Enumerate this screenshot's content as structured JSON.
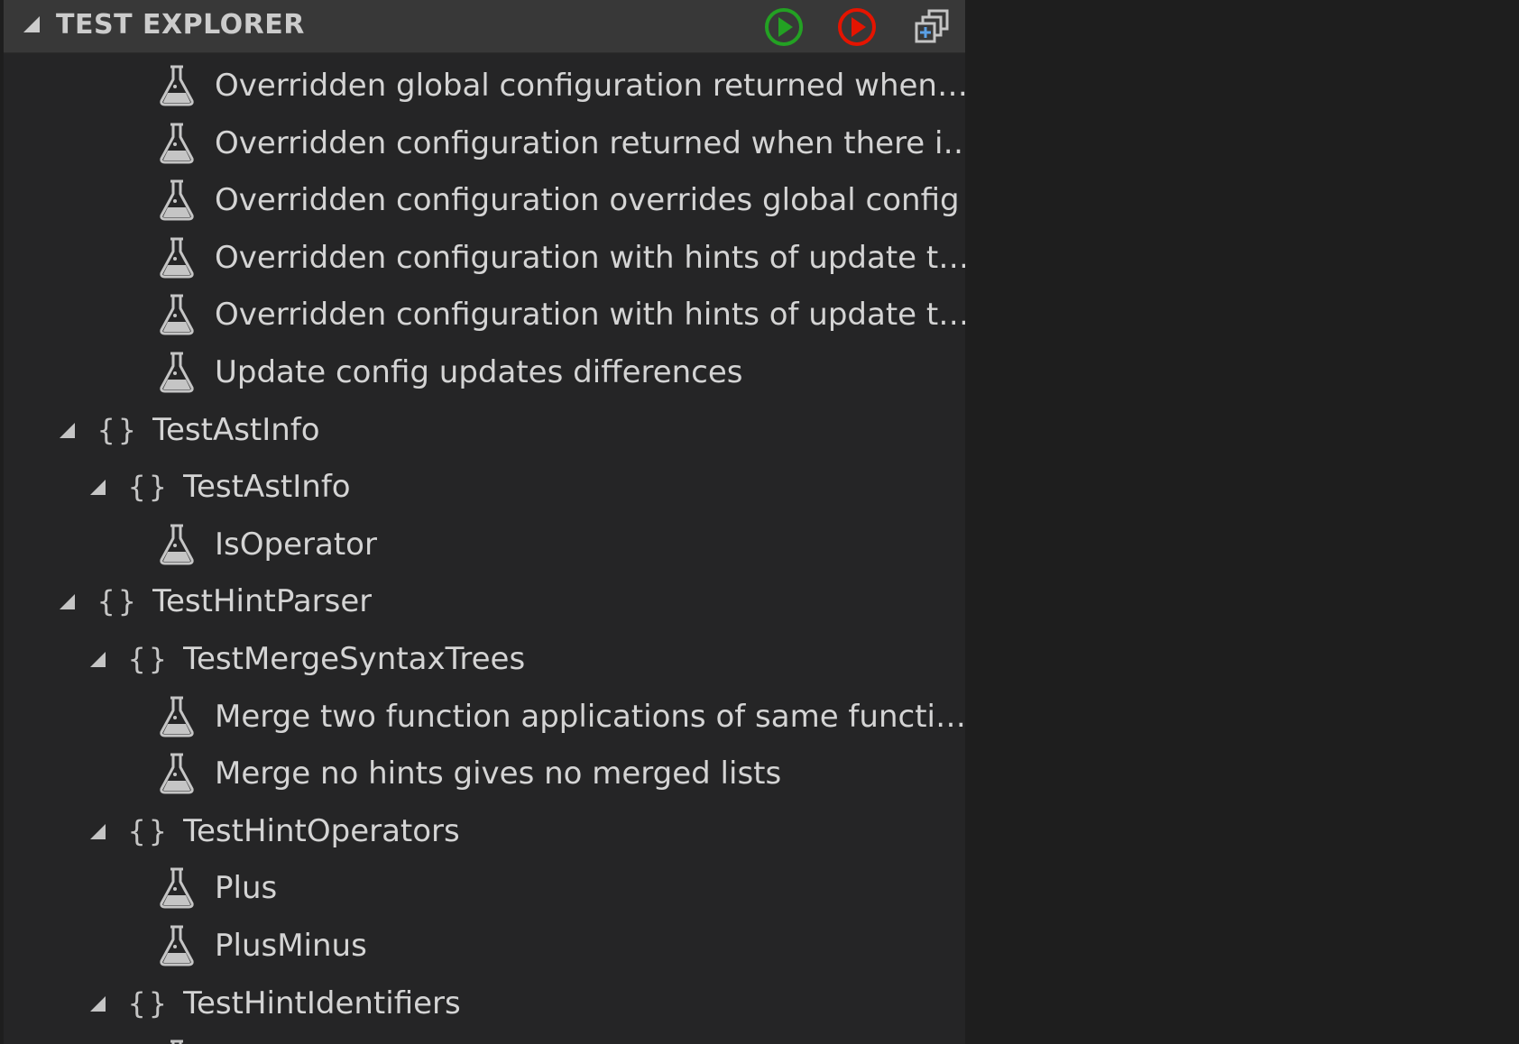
{
  "header": {
    "title": "TEST EXPLORER",
    "run_all_icon": "play-circle-icon",
    "run_all_color": "#23a123",
    "debug_all_icon": "debug-circle-icon",
    "debug_all_color": "#e51400",
    "collapse_all_icon": "collapse-all-icon"
  },
  "tree": [
    {
      "kind": "test",
      "depth": 3,
      "label": "Overridden global configuration returned when…"
    },
    {
      "kind": "test",
      "depth": 3,
      "label": "Overridden configuration returned when there i…"
    },
    {
      "kind": "test",
      "depth": 3,
      "label": "Overridden configuration overrides global config"
    },
    {
      "kind": "test",
      "depth": 3,
      "label": "Overridden configuration with hints of update t…"
    },
    {
      "kind": "test",
      "depth": 3,
      "label": "Overridden configuration with hints of update t…"
    },
    {
      "kind": "test",
      "depth": 3,
      "label": "Update config updates differences"
    },
    {
      "kind": "namespace",
      "depth": 1,
      "label": "TestAstInfo",
      "expanded": true
    },
    {
      "kind": "namespace",
      "depth": 2,
      "label": "TestAstInfo",
      "expanded": true
    },
    {
      "kind": "test",
      "depth": 3,
      "label": "IsOperator"
    },
    {
      "kind": "namespace",
      "depth": 1,
      "label": "TestHintParser",
      "expanded": true
    },
    {
      "kind": "namespace",
      "depth": 2,
      "label": "TestMergeSyntaxTrees",
      "expanded": true
    },
    {
      "kind": "test",
      "depth": 3,
      "label": "Merge two function applications of same functi…"
    },
    {
      "kind": "test",
      "depth": 3,
      "label": "Merge no hints gives no merged lists"
    },
    {
      "kind": "namespace",
      "depth": 2,
      "label": "TestHintOperators",
      "expanded": true
    },
    {
      "kind": "test",
      "depth": 3,
      "label": "Plus"
    },
    {
      "kind": "test",
      "depth": 3,
      "label": "PlusMinus"
    },
    {
      "kind": "namespace",
      "depth": 2,
      "label": "TestHintIdentifiers",
      "expanded": true
    },
    {
      "kind": "test",
      "depth": 3,
      "label": ""
    }
  ],
  "icons": {
    "namespace": "braces-icon",
    "namespace_glyph": "{}",
    "test": "flask-icon",
    "expanded": "chevron-down-icon"
  },
  "colors": {
    "panel_background": "#252526",
    "header_background": "#383838",
    "text": "#d4d4d4"
  }
}
